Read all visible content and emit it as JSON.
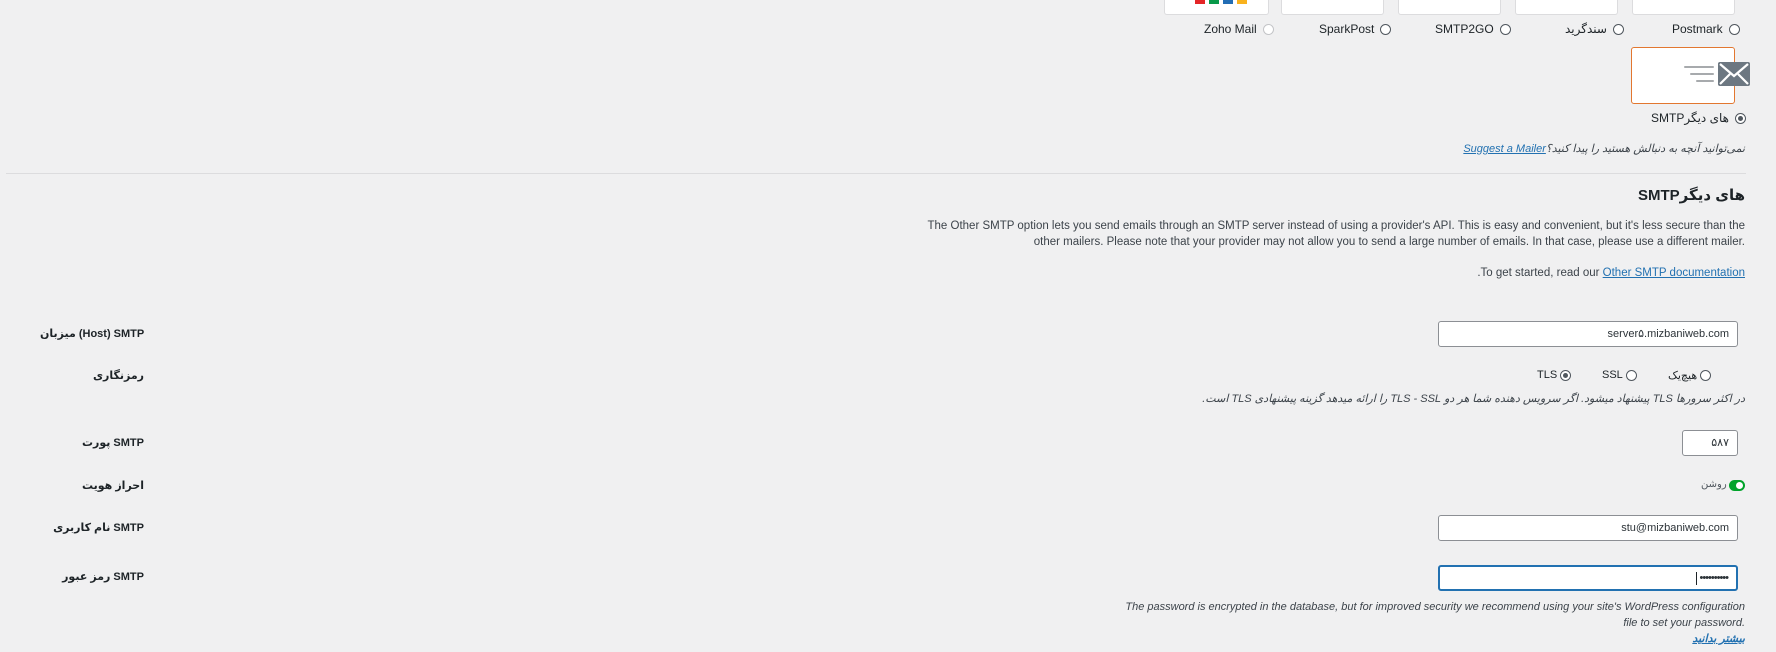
{
  "mailers": {
    "options": [
      {
        "label": "Postmark"
      },
      {
        "label": "سندگرید"
      },
      {
        "label": "SMTP2GO"
      },
      {
        "label": "SparkPost"
      },
      {
        "label": "Zoho Mail"
      }
    ],
    "other_smtp_label": "SMTPهای دیگر"
  },
  "suggest": {
    "question": "نمی‌توانید آنچه به دنبالش هستید را پیدا کنید؟",
    "link_text": "Suggest a Mailer"
  },
  "section": {
    "title": "SMTPهای دیگر",
    "desc_line1": "The Other SMTP option lets you send emails through an SMTP server instead of using a provider's API. This is easy and convenient, but it's less secure than the",
    "desc_line2": "other mailers. Please note that your provider may not allow you to send a large number of emails. In that case, please use a different mailer.",
    "get_started_suffix": ".To get started, read our",
    "docs_link": "Other SMTP documentation"
  },
  "fields": {
    "host": {
      "label": "میزبان (Host) SMTP",
      "value": "server۵.mizbaniweb.com"
    },
    "encryption": {
      "label": "رمزنگاری",
      "options": [
        {
          "label": "هیچ‌یک",
          "checked": false
        },
        {
          "label": "SSL",
          "checked": false
        },
        {
          "label": "TLS",
          "checked": true
        }
      ],
      "hint": "در اکثر سرورها TLS پیشنهاد میشود. اگر سرویس دهنده شما هر دو TLS - SSL را ارائه میدهد گزینه پیشنهادی TLS است."
    },
    "port": {
      "label": "پورت SMTP",
      "value": "۵۸۷"
    },
    "auth": {
      "label": "احراز هویت",
      "state_label": "روشن",
      "enabled": true
    },
    "username": {
      "label": "نام کاربری SMTP",
      "value": "stu@mizbaniweb.com"
    },
    "password": {
      "label": "رمز عبور SMTP",
      "value": "••••••••••",
      "note_line1": "The password is encrypted in the database, but for improved security we recommend using your site's WordPress configuration",
      "note_line2": "file to set your password.",
      "learn_more": "بیشتر بدانید"
    }
  },
  "colors": {
    "accent_blue": "#2271b1",
    "toggle_green": "#00a32a",
    "selected_tile_border": "#e27730",
    "background": "#f0f0f1"
  }
}
